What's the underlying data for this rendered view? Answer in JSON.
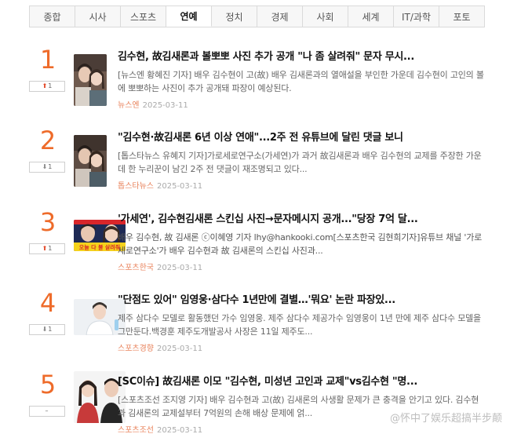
{
  "tabs": [
    {
      "label": "종합",
      "active": false
    },
    {
      "label": "시사",
      "active": false
    },
    {
      "label": "스포츠",
      "active": false
    },
    {
      "label": "연예",
      "active": true
    },
    {
      "label": "정치",
      "active": false
    },
    {
      "label": "경제",
      "active": false
    },
    {
      "label": "사회",
      "active": false
    },
    {
      "label": "세계",
      "active": false
    },
    {
      "label": "IT/과학",
      "active": false
    },
    {
      "label": "포토",
      "active": false
    }
  ],
  "news": [
    {
      "rank": "1",
      "change": {
        "direction": "up",
        "value": "1",
        "arrow": "⬆"
      },
      "title": "김수현, 故김새론과 볼뽀뽀 사진 추가 공개 \"나 좀 살려줘\" 문자 무시...",
      "desc": "[뉴스엔 황혜진 기자] 배우 김수현이 고(故) 배우 김새론과의 열애설을 부인한 가운데 김수현이 고인의 볼에 뽀뽀하는 사진이 추가 공개돼 파장이 예상된다.",
      "source": "뉴스엔",
      "date": "2025-03-11",
      "thumb_icon": "couple-photo-icon"
    },
    {
      "rank": "2",
      "change": {
        "direction": "down",
        "value": "1",
        "arrow": "⬇"
      },
      "title": "\"김수현·故김새론 6년 이상 연애\"...2주 전 유튜브에 달린 댓글 보니",
      "desc": "[톱스타뉴스 유혜지 기자]가로세로연구소(가세연)가 과거 故김새론과 배우 김수현의 교제를 주장한 가운데 한 누리꾼이 남긴 2주 전 댓글이 재조명되고 있다...",
      "source": "톱스타뉴스",
      "date": "2025-03-11",
      "thumb_icon": "couple-photo-icon"
    },
    {
      "rank": "3",
      "change": {
        "direction": "up",
        "value": "1",
        "arrow": "⬆"
      },
      "title": "'가세연', 김수현김새론 스킨십 사진→문자메시지 공개...\"당장 7억 달...",
      "desc": "배우 김수현, 故 김새론 ⓒ이혜영 기자 lhy@hankooki.com[스포츠한국 김현희기자]유튜브 채널 '가로세로연구소'가 배우 김수현과 故 김새론의 스킨십 사진과...",
      "source": "스포츠한국",
      "date": "2025-03-11",
      "thumb_icon": "broadcast-screenshot-icon",
      "thumb_caption": "오늘 다 불 살려줘"
    },
    {
      "rank": "4",
      "change": {
        "direction": "down",
        "value": "1",
        "arrow": "⬇"
      },
      "title": "\"단점도 있어\" 임영웅·삼다수 1년만에 결별…'뭐요' 논란 파장있...",
      "desc": "제주 삼다수 모델로 활동했던 가수 임영웅. 제주 삼다수 제공가수 임영웅이 1년 만에 제주 삼다수 모델을 그만둔다.백경훈 제주도개발공사 사장은 11일 제주도...",
      "source": "스포츠경향",
      "date": "2025-03-11",
      "thumb_icon": "singer-photo-icon"
    },
    {
      "rank": "5",
      "change": {
        "direction": "none",
        "value": "",
        "arrow": "–"
      },
      "title": "[SC이슈] 故김새론 이모 \"김수현, 미성년 고인과 교제\"vs김수현 \"명...",
      "desc": "[스포츠조선 조지영 기자] 배우 김수현과 고(故) 김새론의 사생활 문제가 큰 충격을 안기고 있다. 김수현과 김새론의 교제설부터 7억원의 손해 배상 문제에 얽...",
      "source": "스포츠조선",
      "date": "2025-03-11",
      "thumb_icon": "couple-photo-icon"
    }
  ],
  "watermark": "@怀中了娱乐超搞半步颠",
  "colors": {
    "rank": "#ee6b2a",
    "source": "#e9835c",
    "up": "#e24a2a",
    "down": "#8a8a8a"
  }
}
